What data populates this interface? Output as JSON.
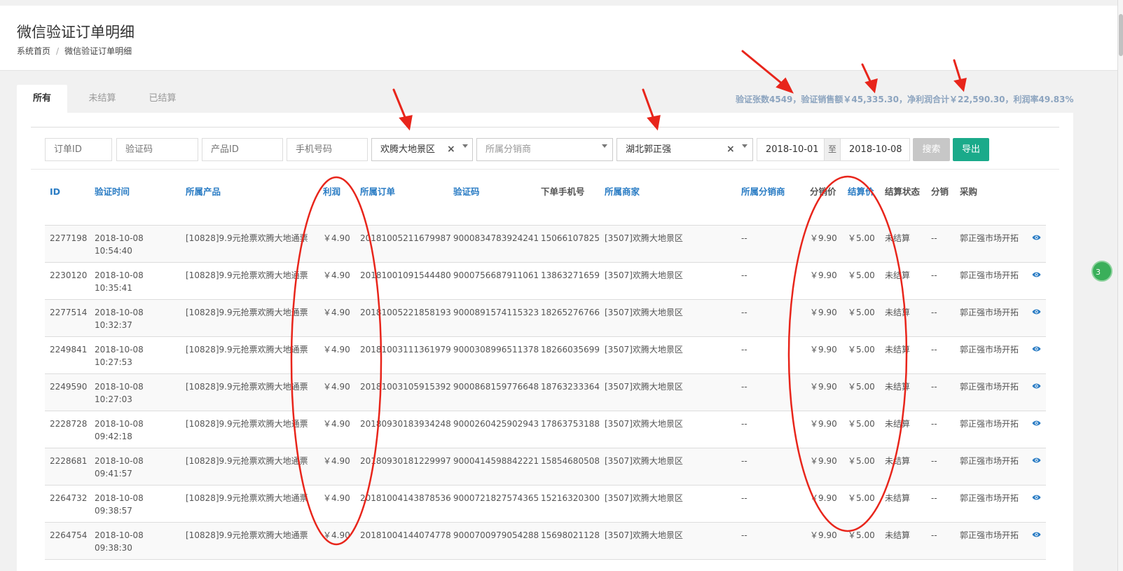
{
  "header": {
    "title": "微信验证订单明细",
    "breadcrumb": [
      "系统首页",
      "微信验证订单明细"
    ]
  },
  "tabs": [
    {
      "label": "所有",
      "active": true
    },
    {
      "label": "未结算",
      "active": false
    },
    {
      "label": "已结算",
      "active": false
    }
  ],
  "summary": "验证张数4549，验证销售额￥45,335.30，净利润合计￥22,590.30，利润率49.83%",
  "filters": {
    "order_id_placeholder": "订单ID",
    "code_placeholder": "验证码",
    "product_placeholder": "产品ID",
    "phone_placeholder": "手机号码",
    "merchant_value": "欢腾大地景区",
    "distributor_placeholder": "所属分销商",
    "buyer_value": "湖北郭正强",
    "date_from": "2018-10-01",
    "date_sep": "至",
    "date_to": "2018-10-08",
    "search_label": "搜索",
    "export_label": "导出"
  },
  "table": {
    "columns": [
      "ID",
      "验证时间",
      "所属产品",
      "利润",
      "所属订单",
      "验证码",
      "下单手机号",
      "所属商家",
      "所属分销商",
      "分销价",
      "结算价",
      "结算状态",
      "分销",
      "采购"
    ],
    "rows": [
      {
        "id": "2277198",
        "date": "2018-10-08",
        "time": "10:54:40",
        "product": "[10828]9.9元抢票欢腾大地通票",
        "profit": "￥4.90",
        "order": "20181005211679987",
        "code": "9000834783924241",
        "phone": "15066107825",
        "merchant": "[3507]欢腾大地景区",
        "distributor": "--",
        "dist_price": "￥9.90",
        "settle_price": "￥5.00",
        "status": "未结算",
        "fx": "--",
        "buyer": "郭正强市场开拓"
      },
      {
        "id": "2230120",
        "date": "2018-10-08",
        "time": "10:35:41",
        "product": "[10828]9.9元抢票欢腾大地通票",
        "profit": "￥4.90",
        "order": "20181001091544480",
        "code": "9000756687911061",
        "phone": "13863271659",
        "merchant": "[3507]欢腾大地景区",
        "distributor": "--",
        "dist_price": "￥9.90",
        "settle_price": "￥5.00",
        "status": "未结算",
        "fx": "--",
        "buyer": "郭正强市场开拓"
      },
      {
        "id": "2277514",
        "date": "2018-10-08",
        "time": "10:32:37",
        "product": "[10828]9.9元抢票欢腾大地通票",
        "profit": "￥4.90",
        "order": "20181005221858193",
        "code": "9000891574115323",
        "phone": "18265276766",
        "merchant": "[3507]欢腾大地景区",
        "distributor": "--",
        "dist_price": "￥9.90",
        "settle_price": "￥5.00",
        "status": "未结算",
        "fx": "--",
        "buyer": "郭正强市场开拓"
      },
      {
        "id": "2249841",
        "date": "2018-10-08",
        "time": "10:27:53",
        "product": "[10828]9.9元抢票欢腾大地通票",
        "profit": "￥4.90",
        "order": "20181003111361979",
        "code": "9000308996511378",
        "phone": "18266035699",
        "merchant": "[3507]欢腾大地景区",
        "distributor": "--",
        "dist_price": "￥9.90",
        "settle_price": "￥5.00",
        "status": "未结算",
        "fx": "--",
        "buyer": "郭正强市场开拓"
      },
      {
        "id": "2249590",
        "date": "2018-10-08",
        "time": "10:27:03",
        "product": "[10828]9.9元抢票欢腾大地通票",
        "profit": "￥4.90",
        "order": "20181003105915392",
        "code": "9000868159776648",
        "phone": "18763233364",
        "merchant": "[3507]欢腾大地景区",
        "distributor": "--",
        "dist_price": "￥9.90",
        "settle_price": "￥5.00",
        "status": "未结算",
        "fx": "--",
        "buyer": "郭正强市场开拓"
      },
      {
        "id": "2228728",
        "date": "2018-10-08",
        "time": "09:42:18",
        "product": "[10828]9.9元抢票欢腾大地通票",
        "profit": "￥4.90",
        "order": "20180930183934248",
        "code": "9000260425902943",
        "phone": "17863753188",
        "merchant": "[3507]欢腾大地景区",
        "distributor": "--",
        "dist_price": "￥9.90",
        "settle_price": "￥5.00",
        "status": "未结算",
        "fx": "--",
        "buyer": "郭正强市场开拓"
      },
      {
        "id": "2228681",
        "date": "2018-10-08",
        "time": "09:41:57",
        "product": "[10828]9.9元抢票欢腾大地通票",
        "profit": "￥4.90",
        "order": "20180930181229997",
        "code": "9000414598842221",
        "phone": "15854680508",
        "merchant": "[3507]欢腾大地景区",
        "distributor": "--",
        "dist_price": "￥9.90",
        "settle_price": "￥5.00",
        "status": "未结算",
        "fx": "--",
        "buyer": "郭正强市场开拓"
      },
      {
        "id": "2264732",
        "date": "2018-10-08",
        "time": "09:38:57",
        "product": "[10828]9.9元抢票欢腾大地通票",
        "profit": "￥4.90",
        "order": "20181004143878536",
        "code": "9000721827574365",
        "phone": "15216320300",
        "merchant": "[3507]欢腾大地景区",
        "distributor": "--",
        "dist_price": "￥9.90",
        "settle_price": "￥5.00",
        "status": "未结算",
        "fx": "--",
        "buyer": "郭正强市场开拓"
      },
      {
        "id": "2264754",
        "date": "2018-10-08",
        "time": "09:38:30",
        "product": "[10828]9.9元抢票欢腾大地通票",
        "profit": "￥4.90",
        "order": "20181004144074778",
        "code": "9000700979054288",
        "phone": "15698021128",
        "merchant": "[3507]欢腾大地景区",
        "distributor": "--",
        "dist_price": "￥9.90",
        "settle_price": "￥5.00",
        "status": "未结算",
        "fx": "--",
        "buyer": "郭正强市场开拓"
      }
    ]
  },
  "side_badge": "3",
  "colors": {
    "link_blue": "#2a7cc4",
    "export_green": "#1aaa8a",
    "annotation_red": "#e8251b"
  }
}
